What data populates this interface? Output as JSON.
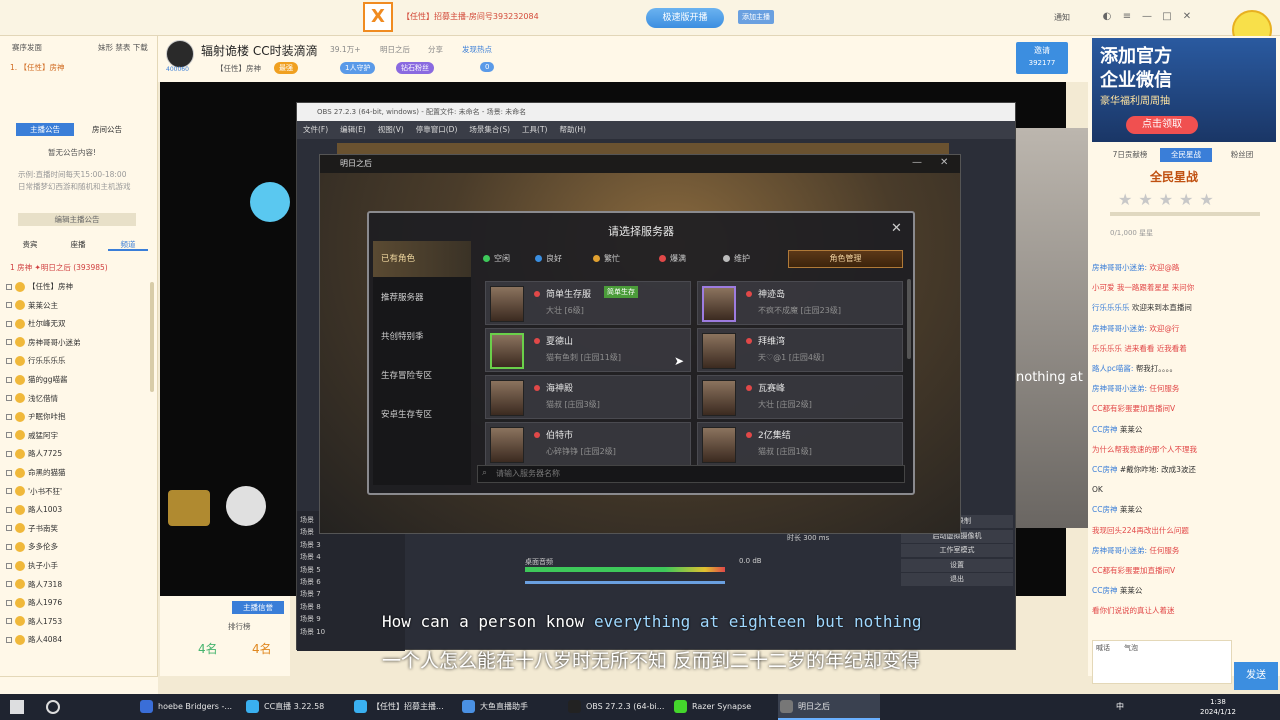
{
  "topbar": {
    "logo": "X",
    "title": "【任性】招募主播-房间号393232084",
    "speed_button": "极速版开播",
    "add_button": "添加主播",
    "notify": "通知"
  },
  "left": {
    "tabs": [
      "赛序发面",
      "妹形 禁表 下载"
    ],
    "user_line": "1. 【任性】房神",
    "announce_tabs": [
      "主播公告",
      "房间公告"
    ],
    "announce_text": "暂无公告内容!",
    "schedule": "示例:直播时间每天15:00-18:00",
    "schedule2": "日常播梦幻西游和随机和主机游戏",
    "edit_button": "编辑主播公告",
    "list_tabs": [
      "贵宾",
      "座播",
      "频道"
    ],
    "list_header": "1 房神 ✦明日之后 (393985)",
    "viewers": [
      "【任性】房神",
      "莱莱公主",
      "杜尔峰无双",
      "房神哥哥小迷弟",
      "行乐乐乐乐",
      "猫的gg喵酱",
      "浅忆借情",
      "ヂ眠你咔抱",
      "戚猛阿宇",
      "路人7725",
      "命黑的猫猫",
      "'小书不狂'",
      "路人1003",
      "子书南笑",
      "多多伦多",
      "执子小手",
      "路人7318",
      "路人1976",
      "路人1753",
      "路人4084"
    ],
    "bottom_btn": "主播信誉",
    "rank_label": "排行榜",
    "count_a": "4名",
    "count_b": "4名"
  },
  "header": {
    "title": "辐射诡楼 CC时装滴滴",
    "room_id": "400060",
    "followers": "39.1万+",
    "game": "明日之后",
    "share": "分享",
    "push": "发现热点",
    "guild": "【任性】房神",
    "lv_badge": "最强",
    "fans_badge": "1人守护",
    "diamond_badge": "钻石粉丝",
    "badge_count": "0",
    "invite_label": "邀请",
    "invite_count": "392177"
  },
  "obs": {
    "title": "OBS 27.2.3 (64-bit, windows) - 配置文件: 未命名 - 场景: 未命名",
    "menu": [
      "文件(F)",
      "编辑(E)",
      "视图(V)",
      "停靠窗口(D)",
      "场景集合(S)",
      "工具(T)",
      "帮助(H)"
    ],
    "scenes": [
      "场景",
      "场景",
      "场景 3",
      "场景 4",
      "场景 5",
      "场景 6",
      "场景 7",
      "场景 8",
      "场景 9",
      "场景 10"
    ],
    "audio_label": "桌面音频",
    "audio_db": "0.0 dB",
    "duration": "时长 300 ms",
    "controls": [
      "开始录制",
      "启动虚拟摄像机",
      "工作室模式",
      "设置",
      "退出"
    ]
  },
  "game": {
    "title": "明日之后",
    "dialog_title": "请选择服务器",
    "side": [
      "已有角色",
      "推荐服务器",
      "共创特别季",
      "生存冒险专区",
      "安卓生存专区"
    ],
    "legend": [
      {
        "label": "空闲",
        "color": "#3ec85a"
      },
      {
        "label": "良好",
        "color": "#3a8ee0"
      },
      {
        "label": "繁忙",
        "color": "#e0a030"
      },
      {
        "label": "爆满",
        "color": "#e04848"
      },
      {
        "label": "维护",
        "color": "#bbbbbb"
      }
    ],
    "role_button": "角色管理",
    "servers": [
      {
        "name": "简单生存服",
        "tag": "简单生存",
        "sub": "大壮 [6级]"
      },
      {
        "name": "神迹岛",
        "tag": "",
        "sub": "不疯不成魔 [庄园23级]"
      },
      {
        "name": "夏德山",
        "tag": "",
        "sub": "猫有鱼刺 [庄园11级]"
      },
      {
        "name": "拜维湾",
        "tag": "",
        "sub": "天♡@1 [庄园4级]"
      },
      {
        "name": "海神殿",
        "tag": "",
        "sub": "猫叔 [庄园3级]"
      },
      {
        "name": "瓦赛峰",
        "tag": "",
        "sub": "大壮 [庄园2级]"
      },
      {
        "name": "伯特市",
        "tag": "",
        "sub": "心碎铮铮 [庄园2级]"
      },
      {
        "name": "2亿集结",
        "tag": "",
        "sub": "猫叔 [庄园1级]"
      }
    ],
    "search_placeholder": "请输入服务器名称"
  },
  "subtitles": {
    "en_a": "How can a person know",
    "en_b": "everything at eighteen but nothing",
    "zh": "一个人怎么能在十八岁时无所不知 反而到二十二岁的年纪却变得"
  },
  "right": {
    "ad_line1": "添加官方",
    "ad_line2": "企业微信",
    "ad_line3": "豪华福利周周抽",
    "ad_button": "点击领取",
    "tabs": [
      "7日贡献榜",
      "全民星战",
      "粉丝团"
    ],
    "star_title": "全民星战",
    "progress": "0/1,000 星星",
    "chat": [
      {
        "u": "房神哥哥小迷弟:",
        "t": "欢迎@路",
        "c": "r"
      },
      {
        "u": "",
        "t": "小可爱 我一路跟着星星 来问你",
        "c": "r"
      },
      {
        "u": "行乐乐乐乐",
        "t": "欢迎来到本直播间",
        "c": ""
      },
      {
        "u": "房神哥哥小迷弟:",
        "t": "欢迎@行",
        "c": "r"
      },
      {
        "u": "",
        "t": "乐乐乐乐 进来看看 近我看着",
        "c": "r"
      },
      {
        "u": "路人pc喵酱:",
        "t": "帮我打。。。。",
        "c": ""
      },
      {
        "u": "房神哥哥小迷弟:",
        "t": "任何服务",
        "c": "r"
      },
      {
        "u": "",
        "t": "CC都有彩蛋要加直播间V",
        "c": "r"
      },
      {
        "u": "CC房神",
        "t": "莱莱公",
        "c": ""
      },
      {
        "u": "",
        "t": "为什么帮我竟速的那个人不理我",
        "c": "r"
      },
      {
        "u": "CC房神",
        "t": "#戴你咋地: 改成3波还",
        "c": ""
      },
      {
        "u": "",
        "t": "OK",
        "c": ""
      },
      {
        "u": "CC房神",
        "t": "莱莱公",
        "c": ""
      },
      {
        "u": "",
        "t": "我现回头224再改出什么问题",
        "c": "r"
      },
      {
        "u": "房神哥哥小迷弟:",
        "t": "任何服务",
        "c": "r"
      },
      {
        "u": "",
        "t": "CC都有彩蛋要加直播间V",
        "c": "r"
      },
      {
        "u": "CC房神",
        "t": "莱莱公",
        "c": ""
      },
      {
        "u": "",
        "t": "看你们说说的真让人着迷",
        "c": "r"
      }
    ],
    "send": "发送",
    "quick": [
      "喊话",
      "气泡"
    ]
  },
  "taskbar": {
    "items": [
      {
        "label": "hoebe Bridgers -...",
        "color": "#3a6ed8"
      },
      {
        "label": "CC直播 3.22.58",
        "color": "#3ab0f0"
      },
      {
        "label": "【任性】招募主播...",
        "color": "#3ab0f0"
      },
      {
        "label": "大鱼直播助手",
        "color": "#4a90e2"
      },
      {
        "label": "OBS 27.2.3 (64-bi...",
        "color": "#222222"
      },
      {
        "label": "Razer Synapse",
        "color": "#44d62c"
      },
      {
        "label": "明日之后",
        "color": "#777777"
      }
    ],
    "ime": "中",
    "time": "1:38",
    "date": "2024/1/12"
  }
}
